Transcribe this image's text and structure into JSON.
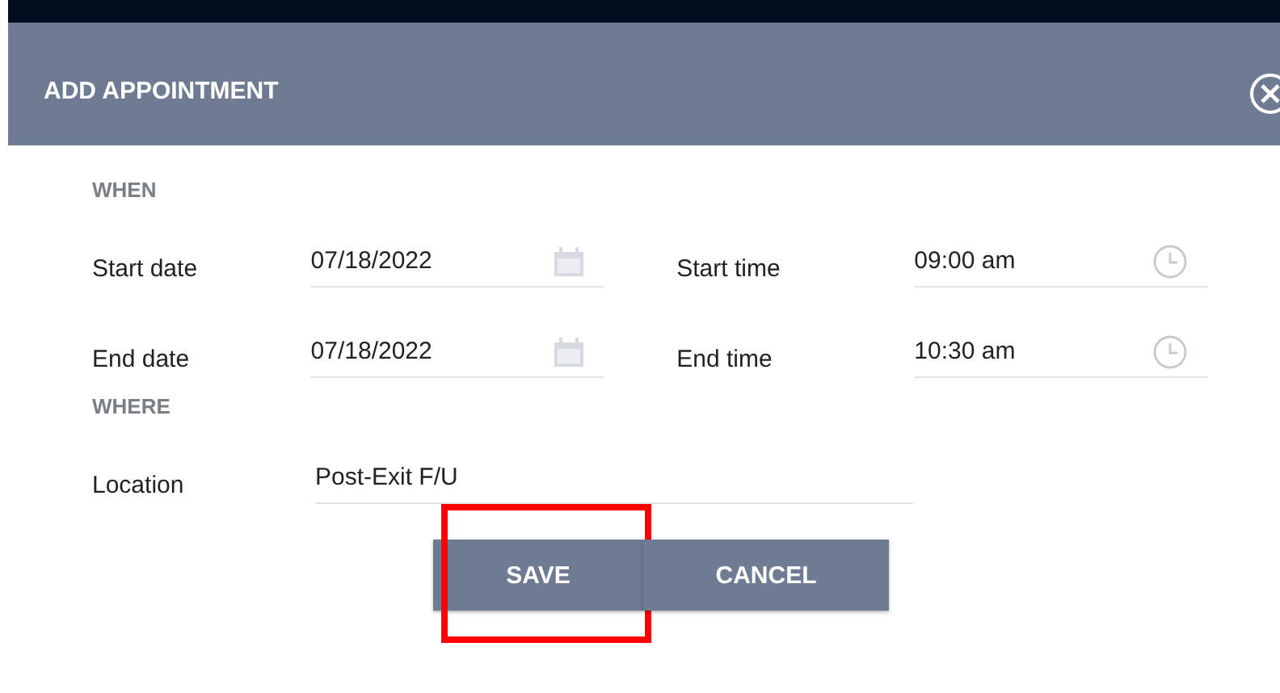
{
  "dialog": {
    "title": "ADD APPOINTMENT",
    "sections": [
      {
        "heading": "WHEN",
        "rows": [
          {
            "fields": [
              {
                "label": "Start date",
                "value": "07/18/2022",
                "kind": "date"
              },
              {
                "label": "Start time",
                "value": "09:00 am",
                "kind": "time"
              }
            ]
          },
          {
            "fields": [
              {
                "label": "End date",
                "value": "07/18/2022",
                "kind": "date"
              },
              {
                "label": "End time",
                "value": "10:30 am",
                "kind": "time"
              }
            ]
          }
        ]
      },
      {
        "heading": "WHERE",
        "rows": [
          {
            "fields": [
              {
                "label": "Location",
                "value": "Post-Exit F/U",
                "kind": "text"
              }
            ]
          }
        ]
      }
    ],
    "buttons": [
      {
        "label": "SAVE",
        "highlighted": true
      },
      {
        "label": "CANCEL",
        "highlighted": false
      }
    ]
  }
}
